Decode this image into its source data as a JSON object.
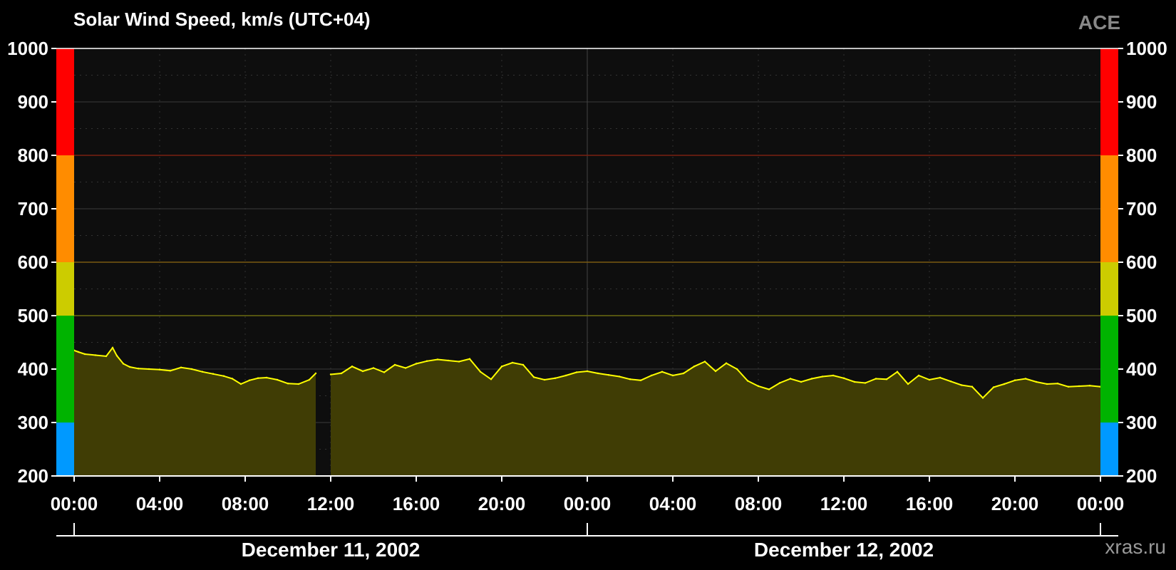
{
  "header": {
    "title": "Solar Wind Speed, km/s (UTC+04)",
    "source": "ACE",
    "credit": "xras.ru"
  },
  "chart_data": {
    "type": "line",
    "title": "Solar Wind Speed, km/s (UTC+04)",
    "ylim": [
      200,
      1000
    ],
    "xlim_hours": [
      0,
      48
    ],
    "y_ticks": [
      "200",
      "300",
      "400",
      "500",
      "600",
      "700",
      "800",
      "900",
      "1000"
    ],
    "x_ticks": [
      "00:00",
      "04:00",
      "08:00",
      "12:00",
      "16:00",
      "20:00",
      "00:00",
      "04:00",
      "08:00",
      "12:00",
      "16:00",
      "20:00",
      "00:00"
    ],
    "dates": [
      "December 11, 2002",
      "December 12, 2002"
    ],
    "grid": true,
    "line_color": "#ffff00",
    "fill_color": "#403d05",
    "bands": [
      {
        "from": 200,
        "to": 300,
        "color": "#0099ff"
      },
      {
        "from": 300,
        "to": 500,
        "color": "#00b300"
      },
      {
        "from": 500,
        "to": 600,
        "color": "#cccc00"
      },
      {
        "from": 600,
        "to": 800,
        "color": "#ff8c00"
      },
      {
        "from": 800,
        "to": 1000,
        "color": "#ff0000"
      }
    ],
    "threshold_lines": [
      {
        "value": 500,
        "color": "#6b6b10"
      },
      {
        "value": 600,
        "color": "#7a5a10"
      },
      {
        "value": 800,
        "color": "#7a2010"
      }
    ],
    "series": [
      {
        "x": [
          0,
          0.2,
          0.5,
          1.0,
          1.5,
          1.8,
          2.0,
          2.3,
          2.6,
          3.0,
          3.5,
          4.0,
          4.5,
          5.0,
          5.5,
          6.0,
          6.5,
          7.0,
          7.4,
          7.8,
          8.2,
          8.6,
          9.0,
          9.5,
          10.0,
          10.5,
          11.0,
          11.3,
          11.7,
          12.0,
          12.5,
          13.0,
          13.5,
          14.0,
          14.5,
          15.0,
          15.5,
          16.0,
          16.5,
          17.0,
          17.5,
          18.0,
          18.5,
          19.0,
          19.5,
          20.0,
          20.5,
          21.0,
          21.5,
          22.0,
          22.5,
          23.0,
          23.5,
          24.0,
          24.5,
          25.0,
          25.5,
          26.0,
          26.5,
          27.0,
          27.5,
          28.0,
          28.5,
          29.0,
          29.5,
          30.0,
          30.5,
          31.0,
          31.5,
          32.0,
          32.5,
          33.0,
          33.5,
          34.0,
          34.5,
          35.0,
          35.5,
          36.0,
          36.5,
          37.0,
          37.5,
          38.0,
          38.5,
          39.0,
          39.5,
          40.0,
          40.5,
          41.0,
          41.5,
          42.0,
          42.5,
          43.0,
          43.5,
          44.0,
          44.5,
          45.0,
          45.5,
          46.0,
          46.5,
          47.0,
          47.5,
          48.0
        ],
        "values": [
          435,
          432,
          428,
          426,
          424,
          440,
          425,
          410,
          404,
          401,
          400,
          399,
          397,
          403,
          400,
          395,
          391,
          387,
          382,
          372,
          379,
          383,
          384,
          380,
          373,
          372,
          380,
          392,
          null,
          390,
          392,
          405,
          396,
          402,
          394,
          408,
          402,
          410,
          415,
          418,
          416,
          414,
          419,
          395,
          381,
          405,
          412,
          408,
          385,
          380,
          383,
          388,
          394,
          396,
          392,
          389,
          386,
          381,
          379,
          388,
          395,
          388,
          392,
          405,
          414,
          396,
          411,
          400,
          378,
          368,
          362,
          374,
          382,
          376,
          382,
          386,
          388,
          383,
          376,
          374,
          382,
          381,
          395,
          372,
          388,
          380,
          384,
          377,
          370,
          367,
          346,
          366,
          372,
          379,
          382,
          376,
          372,
          373,
          367,
          368,
          369,
          367
        ]
      }
    ]
  }
}
